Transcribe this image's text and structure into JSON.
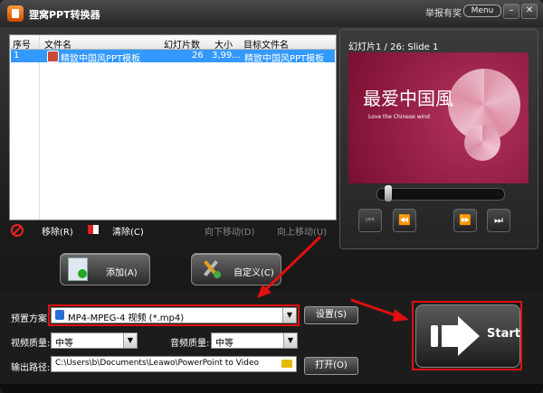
{
  "titlebar": {
    "title": "狸窝PPT转换器",
    "report": "举报有奖",
    "menu": "Menu",
    "minimize": "–",
    "close": "✕"
  },
  "file_list": {
    "columns": [
      "序号",
      "文件名",
      "幻灯片数",
      "大小",
      "目标文件名"
    ],
    "rows": [
      {
        "index": "1",
        "filename": "精致中国风PPT模板",
        "slides": "26",
        "size": "3,99...",
        "target": "精致中国风PPT模板"
      }
    ]
  },
  "list_toolbar": {
    "remove": "移除(R)",
    "clear": "清除(C)",
    "move_down": "向下移动(D)",
    "move_up": "向上移动(U)"
  },
  "actions": {
    "add": "添加(A)",
    "custom": "自定义(C)"
  },
  "preview": {
    "title": "幻灯片1 / 26: Slide 1",
    "slide_title": "最爱中国風",
    "slide_subtitle": "Love the Chinese wind",
    "progress": 0.03
  },
  "settings": {
    "preset_label": "预置方案:",
    "preset_value": "MP4-MPEG-4 视频 (*.mp4)",
    "settings_button": "设置(S)",
    "video_quality_label": "视频质量:",
    "video_quality_value": "中等",
    "audio_quality_label": "音频质量:",
    "audio_quality_value": "中等",
    "output_label": "输出路径:",
    "output_path": "C:\\Users\\b\\Documents\\Leawo\\PowerPoint to Video",
    "open_button": "打开(O)"
  },
  "start": {
    "label": "Start"
  },
  "colors": {
    "selection": "#3399ff",
    "highlight_box": "#e01010",
    "slide_bg": "#9b1f45"
  }
}
